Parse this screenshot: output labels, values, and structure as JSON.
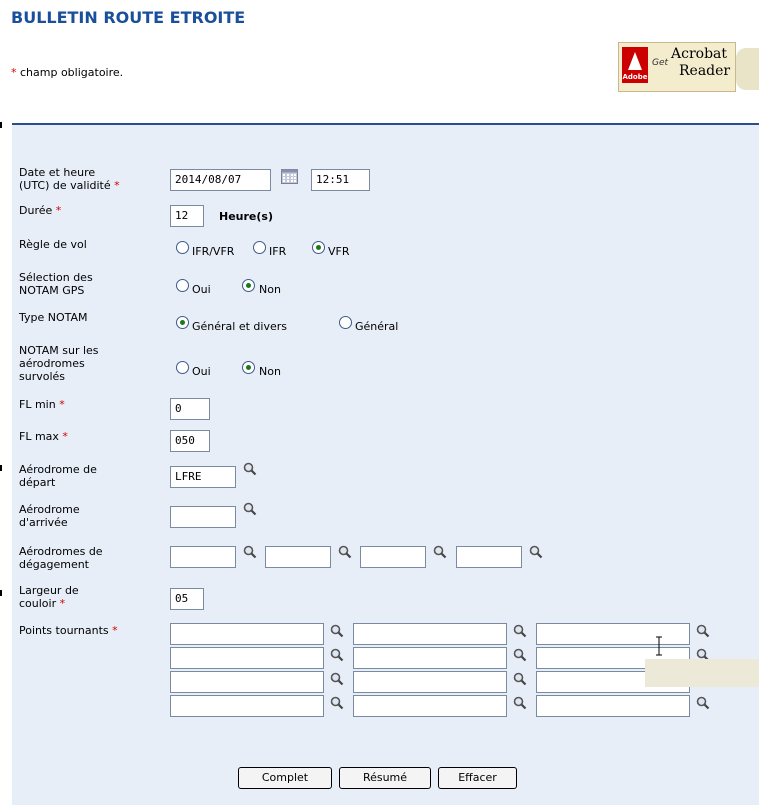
{
  "title": "BULLETIN ROUTE ETROITE",
  "required_note": "champ obligatoire.",
  "required_star": "*",
  "acrobat": {
    "get": "Get",
    "line1": "Acrobat",
    "line2": "Reader",
    "adobe": "Adobe"
  },
  "fields": {
    "date_label_1": "Date et heure",
    "date_label_2": "(UTC) de validité",
    "date_value": "2014/08/07",
    "time_value": "12:51",
    "duree_label": "Durée",
    "duree_value": "12",
    "duree_unit": "Heure(s)",
    "regle_label": "Règle de vol",
    "regle_options": [
      "IFR/VFR",
      "IFR",
      "VFR"
    ],
    "regle_selected": "VFR",
    "gps_label_1": "Sélection des",
    "gps_label_2": "NOTAM GPS",
    "gps_options": [
      "Oui",
      "Non"
    ],
    "gps_selected": "Non",
    "type_label": "Type NOTAM",
    "type_options": [
      "Général et divers",
      "Général"
    ],
    "type_selected": "Général et divers",
    "survol_label_1": "NOTAM sur les",
    "survol_label_2": "aérodromes",
    "survol_label_3": "survolés",
    "survol_options": [
      "Oui",
      "Non"
    ],
    "survol_selected": "Non",
    "flmin_label": "FL min",
    "flmin_value": "0",
    "flmax_label": "FL max",
    "flmax_value": "050",
    "depart_label_1": "Aérodrome de",
    "depart_label_2": "départ",
    "depart_value": "LFRE",
    "arrivee_label_1": "Aérodrome",
    "arrivee_label_2": "d'arrivée",
    "arrivee_value": "",
    "degag_label_1": "Aérodromes de",
    "degag_label_2": "dégagement",
    "couloir_label_1": "Largeur de",
    "couloir_label_2": "couloir",
    "couloir_value": "05",
    "points_label": "Points tournants"
  },
  "buttons": {
    "complet": "Complet",
    "resume": "Résumé",
    "effacer": "Effacer"
  },
  "icons": {
    "search": "search-icon",
    "calendar": "calendar-icon"
  }
}
